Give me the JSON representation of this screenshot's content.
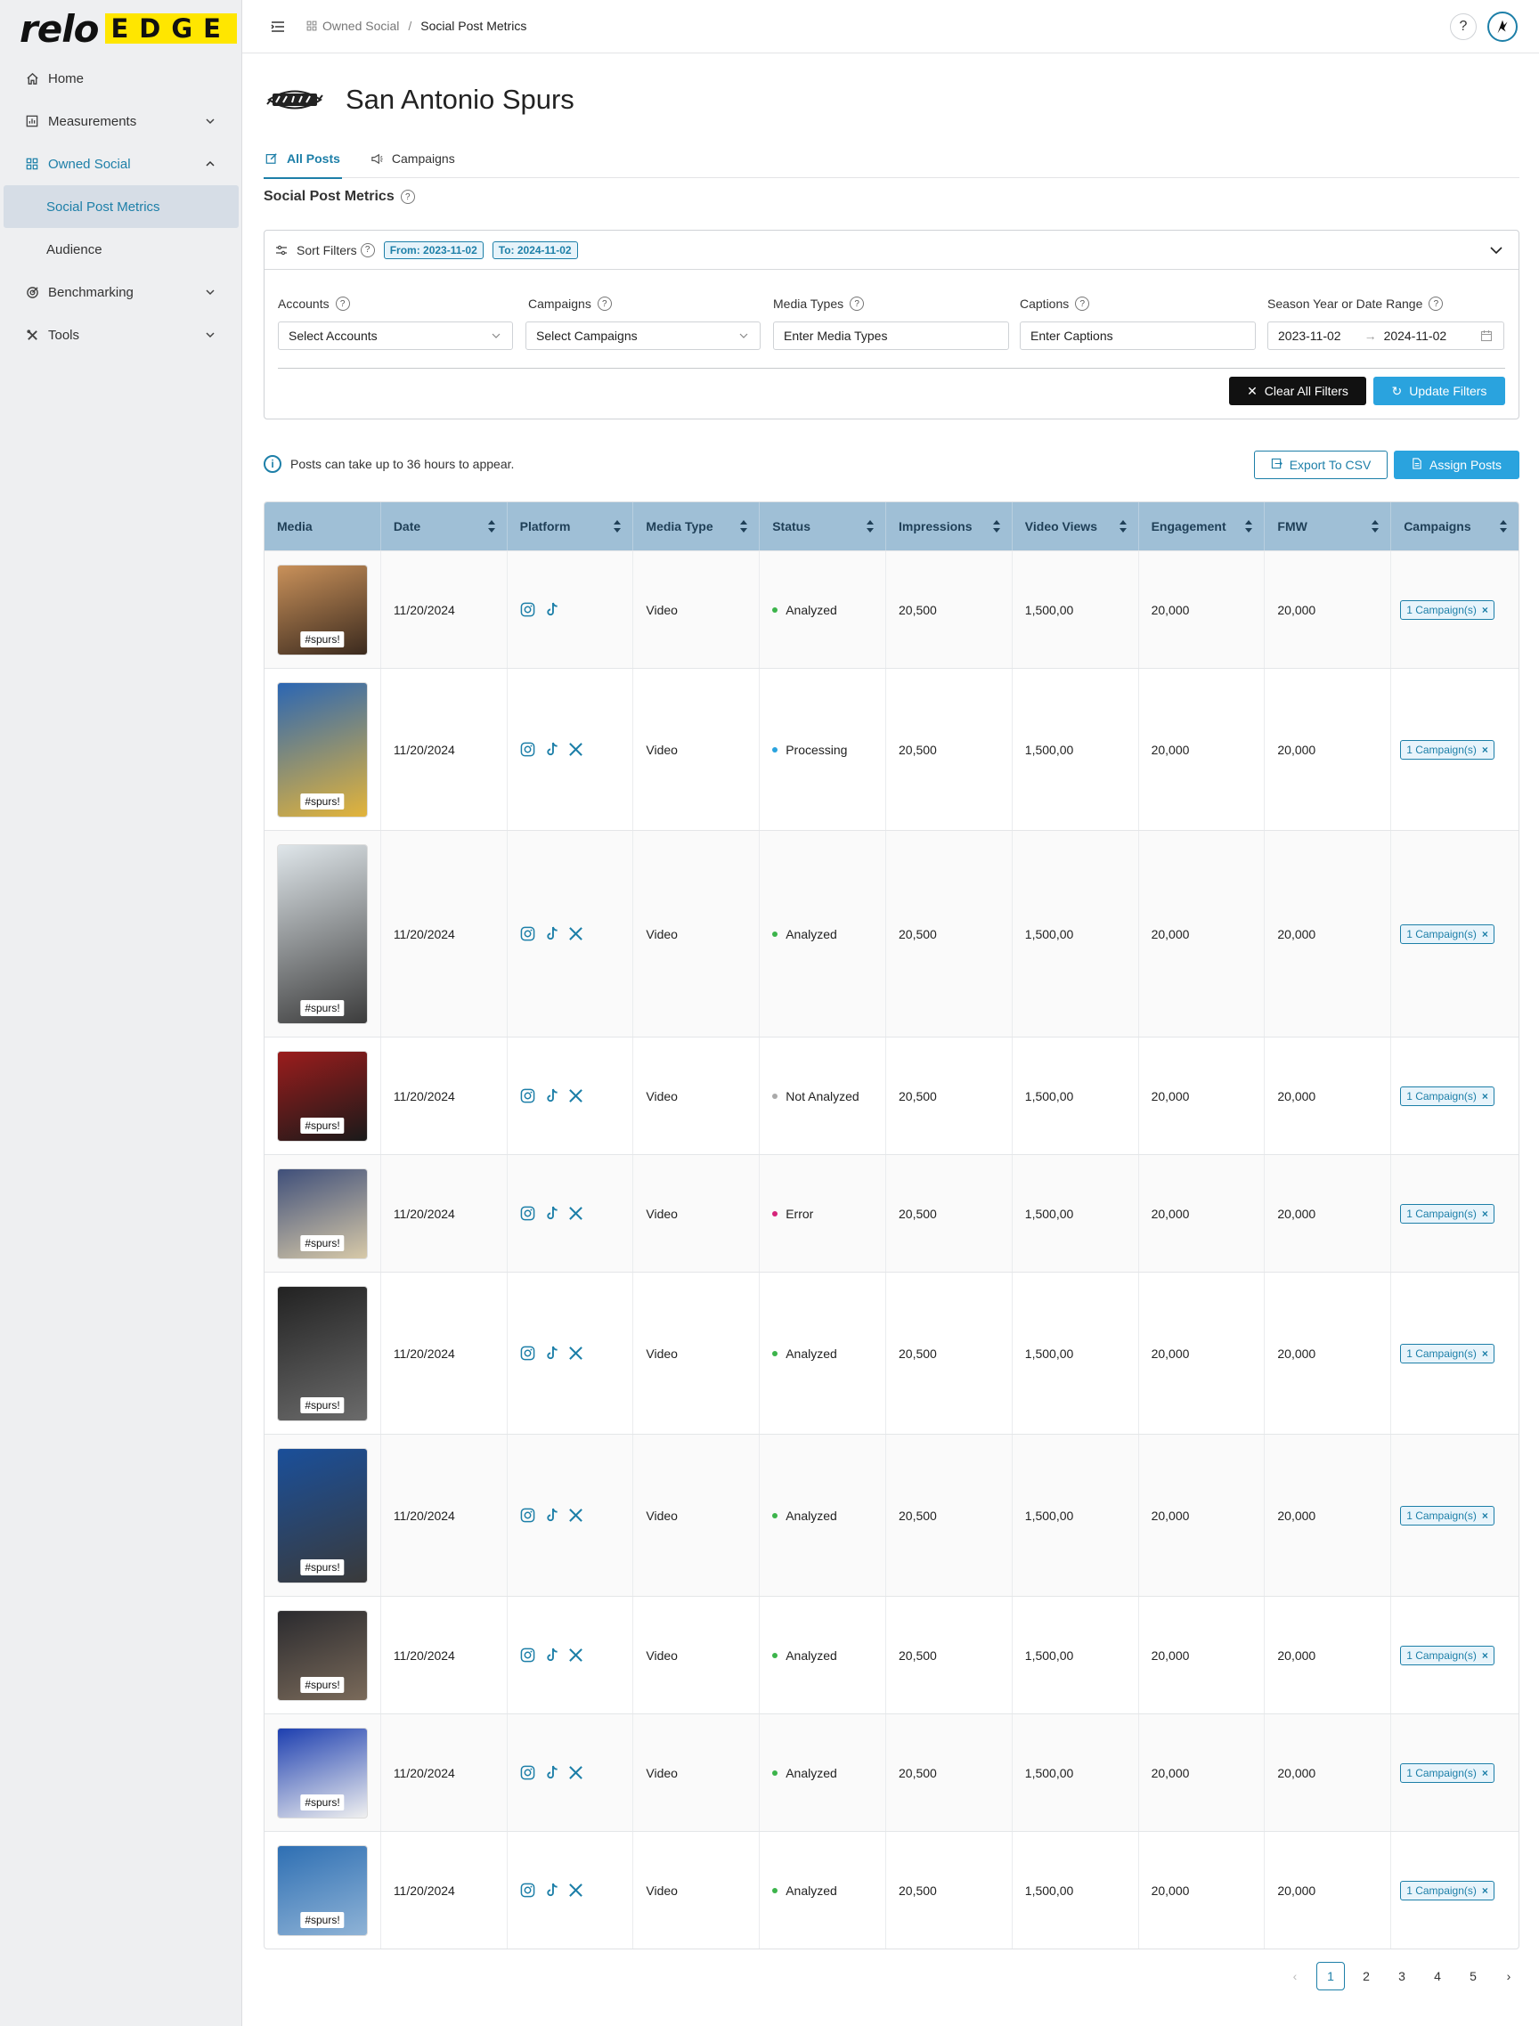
{
  "brand": {
    "relo": "relo",
    "edge": "EDGE"
  },
  "sidebar": {
    "items": [
      {
        "label": "Home",
        "icon": "home-icon"
      },
      {
        "label": "Measurements",
        "icon": "chart-box-icon"
      },
      {
        "label": "Owned Social",
        "icon": "grid-icon"
      },
      {
        "label": "Benchmarking",
        "icon": "target-icon"
      },
      {
        "label": "Tools",
        "icon": "tools-icon"
      }
    ],
    "sub_items": [
      {
        "label": "Social Post Metrics"
      },
      {
        "label": "Audience"
      }
    ]
  },
  "header": {
    "crumb_parent": "Owned Social",
    "crumb_sep": "/",
    "crumb_current": "Social Post Metrics",
    "help": "?"
  },
  "team": {
    "name": "San Antonio Spurs"
  },
  "tabs": [
    {
      "label": "All Posts"
    },
    {
      "label": "Campaigns"
    }
  ],
  "section": {
    "title": "Social Post Metrics",
    "help": "?"
  },
  "filters": {
    "header_label": "Sort Filters",
    "from_chip": "From: 2023-11-02",
    "to_chip": "To: 2024-11-02",
    "accounts_label": "Accounts",
    "accounts_placeholder": "Select Accounts",
    "campaigns_label": "Campaigns",
    "campaigns_placeholder": "Select Campaigns",
    "media_types_label": "Media Types",
    "media_types_placeholder": "Enter Media Types",
    "captions_label": "Captions",
    "captions_placeholder": "Enter Captions",
    "season_label": "Season Year or Date Range",
    "date_from": "2023-11-02",
    "date_to": "2024-11-02",
    "date_arrow": "→",
    "clear_label": "Clear All Filters",
    "update_label": "Update Filters",
    "help": "?"
  },
  "notice": {
    "text": "Posts can take up to 36 hours to appear.",
    "icon_text": "i"
  },
  "actions": {
    "export_label": "Export To CSV",
    "assign_label": "Assign Posts"
  },
  "table": {
    "columns": [
      "Media",
      "Date",
      "Platform",
      "Media Type",
      "Status",
      "Impressions",
      "Video Views",
      "Engagement",
      "FMW",
      "Campaigns"
    ],
    "rows": [
      {
        "tag": "#spurs!",
        "date": "11/20/2024",
        "platforms": [
          "instagram",
          "tiktok"
        ],
        "media_type": "Video",
        "status": "Analyzed",
        "status_color": "#3cb44b",
        "impressions": "20,500",
        "views": "1,500,00",
        "engagement": "20,000",
        "fmw": "20,000",
        "campaigns": "1 Campaign(s)",
        "x": "×"
      },
      {
        "tag": "#spurs!",
        "date": "11/20/2024",
        "platforms": [
          "instagram",
          "tiktok",
          "x"
        ],
        "media_type": "Video",
        "status": "Processing",
        "status_color": "#2aa3de",
        "impressions": "20,500",
        "views": "1,500,00",
        "engagement": "20,000",
        "fmw": "20,000",
        "campaigns": "1 Campaign(s)",
        "x": "×"
      },
      {
        "tag": "#spurs!",
        "date": "11/20/2024",
        "platforms": [
          "instagram",
          "tiktok",
          "x"
        ],
        "media_type": "Video",
        "status": "Analyzed",
        "status_color": "#3cb44b",
        "impressions": "20,500",
        "views": "1,500,00",
        "engagement": "20,000",
        "fmw": "20,000",
        "campaigns": "1 Campaign(s)",
        "x": "×"
      },
      {
        "tag": "#spurs!",
        "date": "11/20/2024",
        "platforms": [
          "instagram",
          "tiktok",
          "x"
        ],
        "media_type": "Video",
        "status": "Not Analyzed",
        "status_color": "#aaaaaa",
        "impressions": "20,500",
        "views": "1,500,00",
        "engagement": "20,000",
        "fmw": "20,000",
        "campaigns": "1 Campaign(s)",
        "x": "×"
      },
      {
        "tag": "#spurs!",
        "date": "11/20/2024",
        "platforms": [
          "instagram",
          "tiktok",
          "x"
        ],
        "media_type": "Video",
        "status": "Error",
        "status_color": "#d6247a",
        "impressions": "20,500",
        "views": "1,500,00",
        "engagement": "20,000",
        "fmw": "20,000",
        "campaigns": "1 Campaign(s)",
        "x": "×"
      },
      {
        "tag": "#spurs!",
        "date": "11/20/2024",
        "platforms": [
          "instagram",
          "tiktok",
          "x"
        ],
        "media_type": "Video",
        "status": "Analyzed",
        "status_color": "#3cb44b",
        "impressions": "20,500",
        "views": "1,500,00",
        "engagement": "20,000",
        "fmw": "20,000",
        "campaigns": "1 Campaign(s)",
        "x": "×"
      },
      {
        "tag": "#spurs!",
        "date": "11/20/2024",
        "platforms": [
          "instagram",
          "tiktok",
          "x"
        ],
        "media_type": "Video",
        "status": "Analyzed",
        "status_color": "#3cb44b",
        "impressions": "20,500",
        "views": "1,500,00",
        "engagement": "20,000",
        "fmw": "20,000",
        "campaigns": "1 Campaign(s)",
        "x": "×"
      },
      {
        "tag": "#spurs!",
        "date": "11/20/2024",
        "platforms": [
          "instagram",
          "tiktok",
          "x"
        ],
        "media_type": "Video",
        "status": "Analyzed",
        "status_color": "#3cb44b",
        "impressions": "20,500",
        "views": "1,500,00",
        "engagement": "20,000",
        "fmw": "20,000",
        "campaigns": "1 Campaign(s)",
        "x": "×"
      },
      {
        "tag": "#spurs!",
        "date": "11/20/2024",
        "platforms": [
          "instagram",
          "tiktok",
          "x"
        ],
        "media_type": "Video",
        "status": "Analyzed",
        "status_color": "#3cb44b",
        "impressions": "20,500",
        "views": "1,500,00",
        "engagement": "20,000",
        "fmw": "20,000",
        "campaigns": "1 Campaign(s)",
        "x": "×"
      },
      {
        "tag": "#spurs!",
        "date": "11/20/2024",
        "platforms": [
          "instagram",
          "tiktok",
          "x"
        ],
        "media_type": "Video",
        "status": "Analyzed",
        "status_color": "#3cb44b",
        "impressions": "20,500",
        "views": "1,500,00",
        "engagement": "20,000",
        "fmw": "20,000",
        "campaigns": "1 Campaign(s)",
        "x": "×"
      }
    ]
  },
  "pagination": {
    "pages": [
      "1",
      "2",
      "3",
      "4",
      "5"
    ],
    "current": "1",
    "prev": "‹",
    "next": "›"
  },
  "colors": {
    "accent": "#1d7fa8",
    "button_blue": "#2aa3de",
    "header_row": "#9fbfd6",
    "brand_yellow": "#ffe600"
  }
}
